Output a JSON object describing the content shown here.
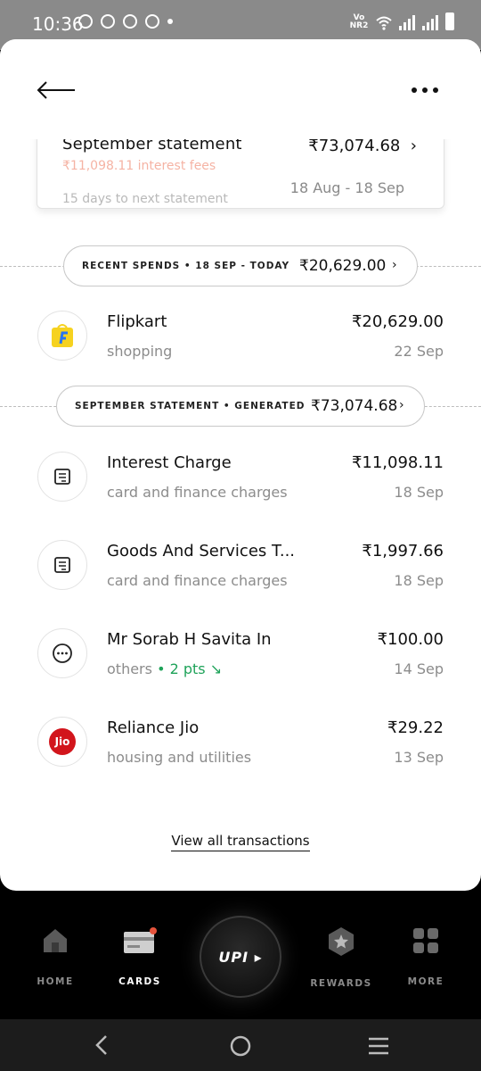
{
  "status_bar": {
    "time": "10:36",
    "network_label": "Vo NR2"
  },
  "header": {
    "back_icon": "back-arrow-icon",
    "menu_icon": "more-dots-icon"
  },
  "statement_card": {
    "title": "September statement",
    "amount": "₹73,074.68",
    "faded_line_1": "₹11,098.11 interest fees",
    "date_range": "18 Aug - 18 Sep",
    "faded_line_2": "15 days to next statement"
  },
  "recent_pill": {
    "label": "RECENT SPENDS  •  18 SEP - TODAY",
    "amount": "₹20,629.00"
  },
  "statement_pill": {
    "label": "SEPTEMBER STATEMENT  •  GENERATED",
    "amount": "₹73,074.68"
  },
  "transactions": [
    {
      "name": "Flipkart",
      "category": "shopping",
      "amount": "₹20,629.00",
      "date": "22 Sep",
      "icon": "flipkart-logo-icon"
    },
    {
      "name": "Interest Charge",
      "category": "card and finance charges",
      "amount": "₹11,098.11",
      "date": "18 Sep",
      "icon": "receipt-icon"
    },
    {
      "name": "Goods And Services T...",
      "category": "card and finance charges",
      "amount": "₹1,997.66",
      "date": "18 Sep",
      "icon": "receipt-icon"
    },
    {
      "name": "Mr Sorab H Savita In",
      "category": "others",
      "points": "• 2 pts ↘",
      "amount": "₹100.00",
      "date": "14 Sep",
      "icon": "ellipsis-circle-icon"
    },
    {
      "name": "Reliance Jio",
      "category": "housing and utilities",
      "amount": "₹29.22",
      "date": "13 Sep",
      "icon": "jio-logo-icon",
      "logo_text": "Jio"
    }
  ],
  "view_all_label": "View all transactions",
  "bottom_nav": {
    "items": [
      {
        "label": "HOME",
        "icon": "home-icon",
        "active": false
      },
      {
        "label": "CARDS",
        "icon": "card-icon",
        "active": true
      },
      {
        "label": "REWARDS",
        "icon": "star-badge-icon",
        "active": false
      },
      {
        "label": "MORE",
        "icon": "grid-icon",
        "active": false
      }
    ],
    "upi_label": "UPI"
  },
  "colors": {
    "accent_green": "#1fa35a",
    "badge_red": "#e5533c",
    "jio_red": "#d2151c",
    "flipkart_yellow": "#f6d21f",
    "flipkart_blue": "#2874f0"
  }
}
